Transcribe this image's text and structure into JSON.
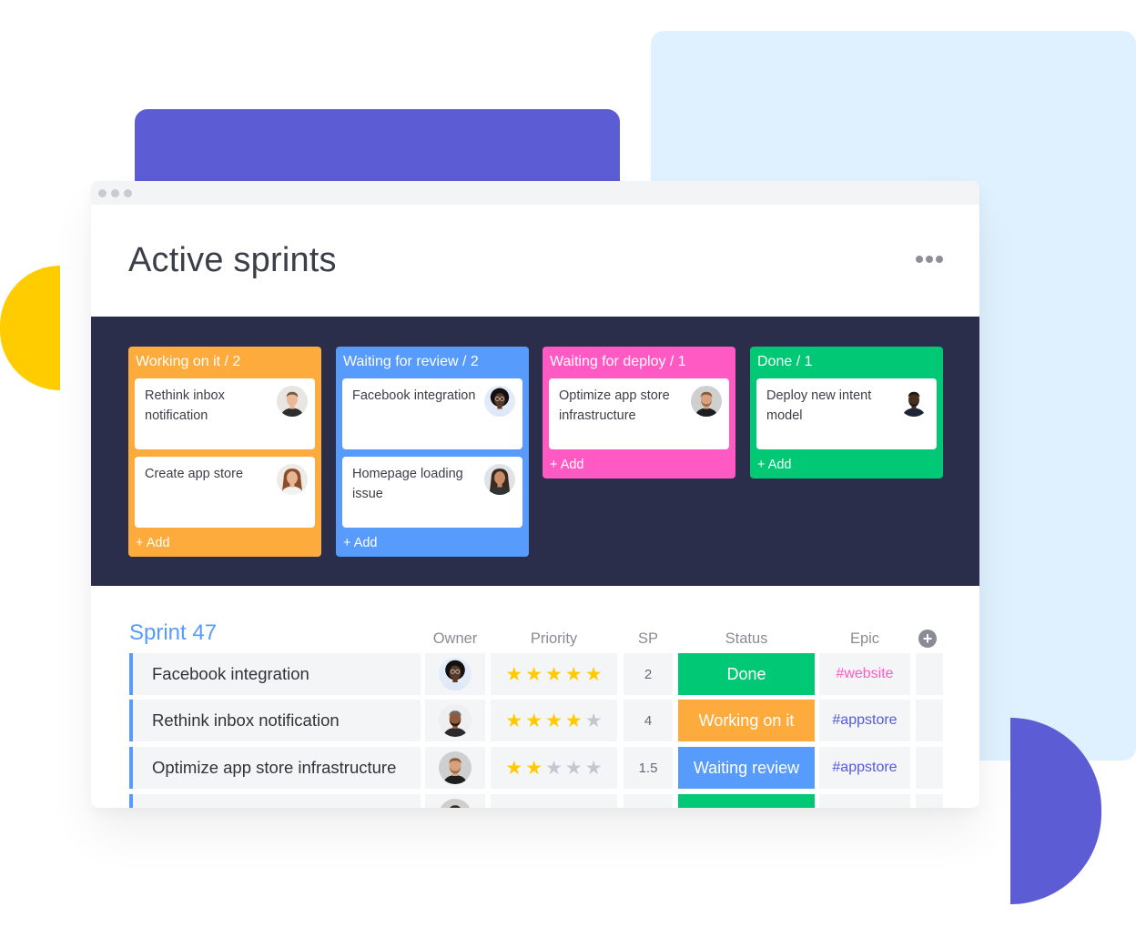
{
  "colors": {
    "orange": "#fdab3d",
    "blue": "#579bfc",
    "pink": "#ff5ac4",
    "green": "#00c875",
    "navy": "#2b2e4b",
    "purple": "#5c5cd4",
    "light_blue": "#dff0fe",
    "yellow": "#ffcc00",
    "star_on": "#ffcb00",
    "star_off": "#c5c7d0",
    "epic_website": "#ff5ac4",
    "epic_appstore": "#5559df"
  },
  "window": {
    "title_dots": 3
  },
  "header": {
    "title": "Active sprints",
    "more_icon": "more-horizontal-icon"
  },
  "kanban": {
    "columns": [
      {
        "title": "Working on it / 2",
        "color": "#fdab3d",
        "cards": [
          {
            "text": "Rethink inbox notification",
            "avatar": "man-light-hair"
          },
          {
            "text": "Create app store",
            "avatar": "woman-curly-hair"
          }
        ],
        "add_label": "+ Add"
      },
      {
        "title": "Waiting for review / 2",
        "color": "#579bfc",
        "cards": [
          {
            "text": "Facebook integration",
            "avatar": "woman-glasses"
          },
          {
            "text": "Homepage loading issue",
            "avatar": "woman-long-hair"
          }
        ],
        "add_label": "+ Add"
      },
      {
        "title": "Waiting for deploy / 1",
        "color": "#ff5ac4",
        "cards": [
          {
            "text": "Optimize app store infrastructure",
            "avatar": "man-beard"
          }
        ],
        "add_label": "+ Add"
      },
      {
        "title": "Done / 1",
        "color": "#00c875",
        "cards": [
          {
            "text": "Deploy new intent model",
            "avatar": "man-dark-skin"
          }
        ],
        "add_label": "+ Add"
      }
    ]
  },
  "sprint": {
    "title": "Sprint 47",
    "columns": [
      "Owner",
      "Priority",
      "SP",
      "Status",
      "Epic"
    ],
    "add_column_icon": "plus-circle-icon",
    "rows": [
      {
        "name": "Facebook integration",
        "owner": "woman-glasses",
        "priority": 5,
        "sp": "2",
        "status": "Done",
        "status_color": "#00c875",
        "epic": "#website",
        "epic_color": "#ff5ac4"
      },
      {
        "name": "Rethink inbox notification",
        "owner": "man-cap",
        "priority": 4,
        "sp": "4",
        "status": "Working on it",
        "status_color": "#fdab3d",
        "epic": "#appstore",
        "epic_color": "#5559df"
      },
      {
        "name": "Optimize app store infrastructure",
        "owner": "man-beard",
        "priority": 2,
        "sp": "1.5",
        "status": "Waiting review",
        "status_color": "#579bfc",
        "epic": "#appstore",
        "epic_color": "#5559df"
      },
      {
        "name": "",
        "owner": "man-partial",
        "priority": 0,
        "sp": "",
        "status": "",
        "status_color": "#00c875",
        "epic": "",
        "epic_color": "#5559df"
      }
    ],
    "priority_max": 5
  }
}
